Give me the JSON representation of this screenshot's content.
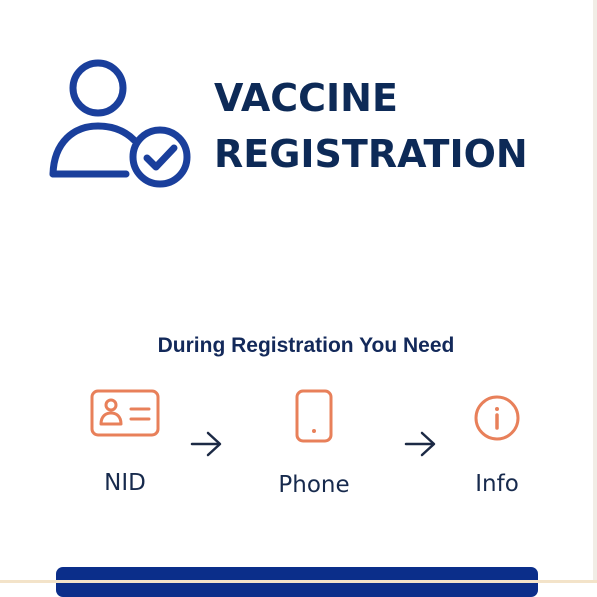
{
  "header": {
    "icon": "user-check-icon",
    "title_line1": "VACCINE",
    "title_line2": "REGISTRATION"
  },
  "requirements": {
    "heading": "During Registration You Need",
    "items": [
      {
        "icon": "id-card-icon",
        "label": "NID"
      },
      {
        "icon": "smartphone-icon",
        "label": "Phone"
      },
      {
        "icon": "info-icon",
        "label": "Info"
      }
    ],
    "separator_icon": "arrow-right-icon"
  },
  "colors": {
    "title": "#0d2a57",
    "accent_icon": "#e8805a",
    "header_icon": "#1a3f9c",
    "button": "#0b2e8a"
  }
}
